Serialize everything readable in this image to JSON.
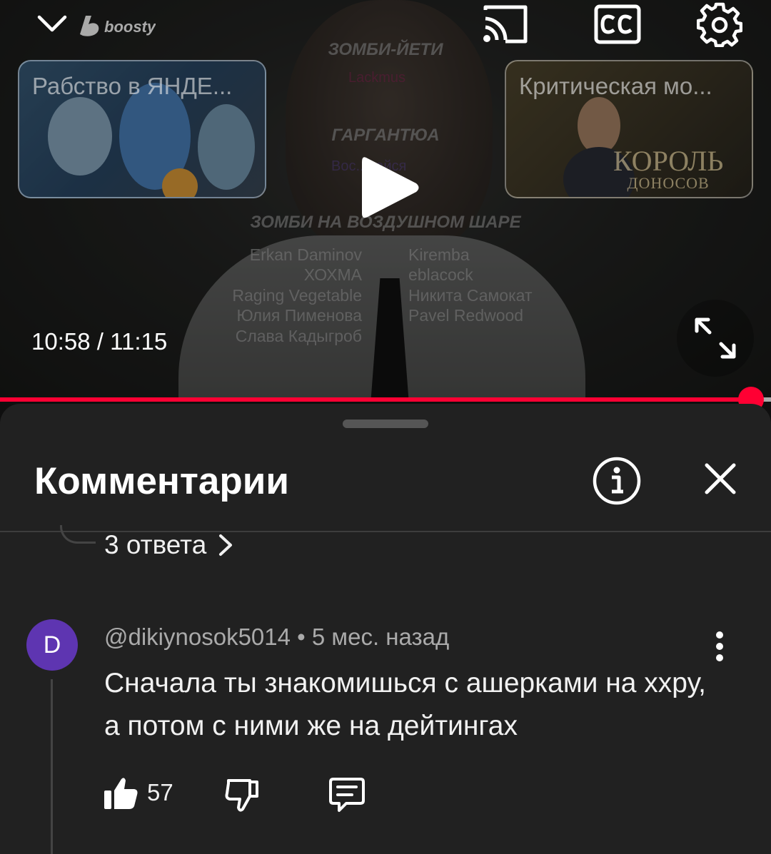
{
  "player": {
    "brand": "boosty",
    "time": "10:58 / 11:15",
    "progress": 0.974,
    "endcards": [
      {
        "title": "Рабство в ЯНДЕ..."
      },
      {
        "title": "Критическая мо...",
        "caption_big": "КОРОЛЬ",
        "caption_small": "ДОНОСОВ"
      }
    ],
    "credits": {
      "heading1": "ЗОМБИ-ЙЕТИ",
      "pink1": "Lackmus",
      "heading2": "ГАРГАНТЮА",
      "purple1": "Вос.....айся",
      "heading3": "ЗОМБИ НА ВОЗДУШНОМ ШАРЕ",
      "left": [
        "Erkan Daminov",
        "ХОХМА",
        "Raging Vegetable",
        "Юлия Пименова",
        "Слава Кадыгроб"
      ],
      "right": [
        "Kiremba",
        "eblacock",
        "Никита Самокат",
        "Pavel Redwood"
      ]
    },
    "colors": {
      "progress": "#ff0033"
    }
  },
  "sheet": {
    "title": "Комментарии",
    "replies_link": "3 ответа"
  },
  "comment": {
    "avatar_letter": "D",
    "avatar_color": "#5e35b1",
    "meta": "@dikiynosok5014 • 5 мес. назад",
    "text": "Сначала ты знакомишься с ашерками на ххру, а потом с ними же на дейтингах",
    "likes": "57"
  }
}
